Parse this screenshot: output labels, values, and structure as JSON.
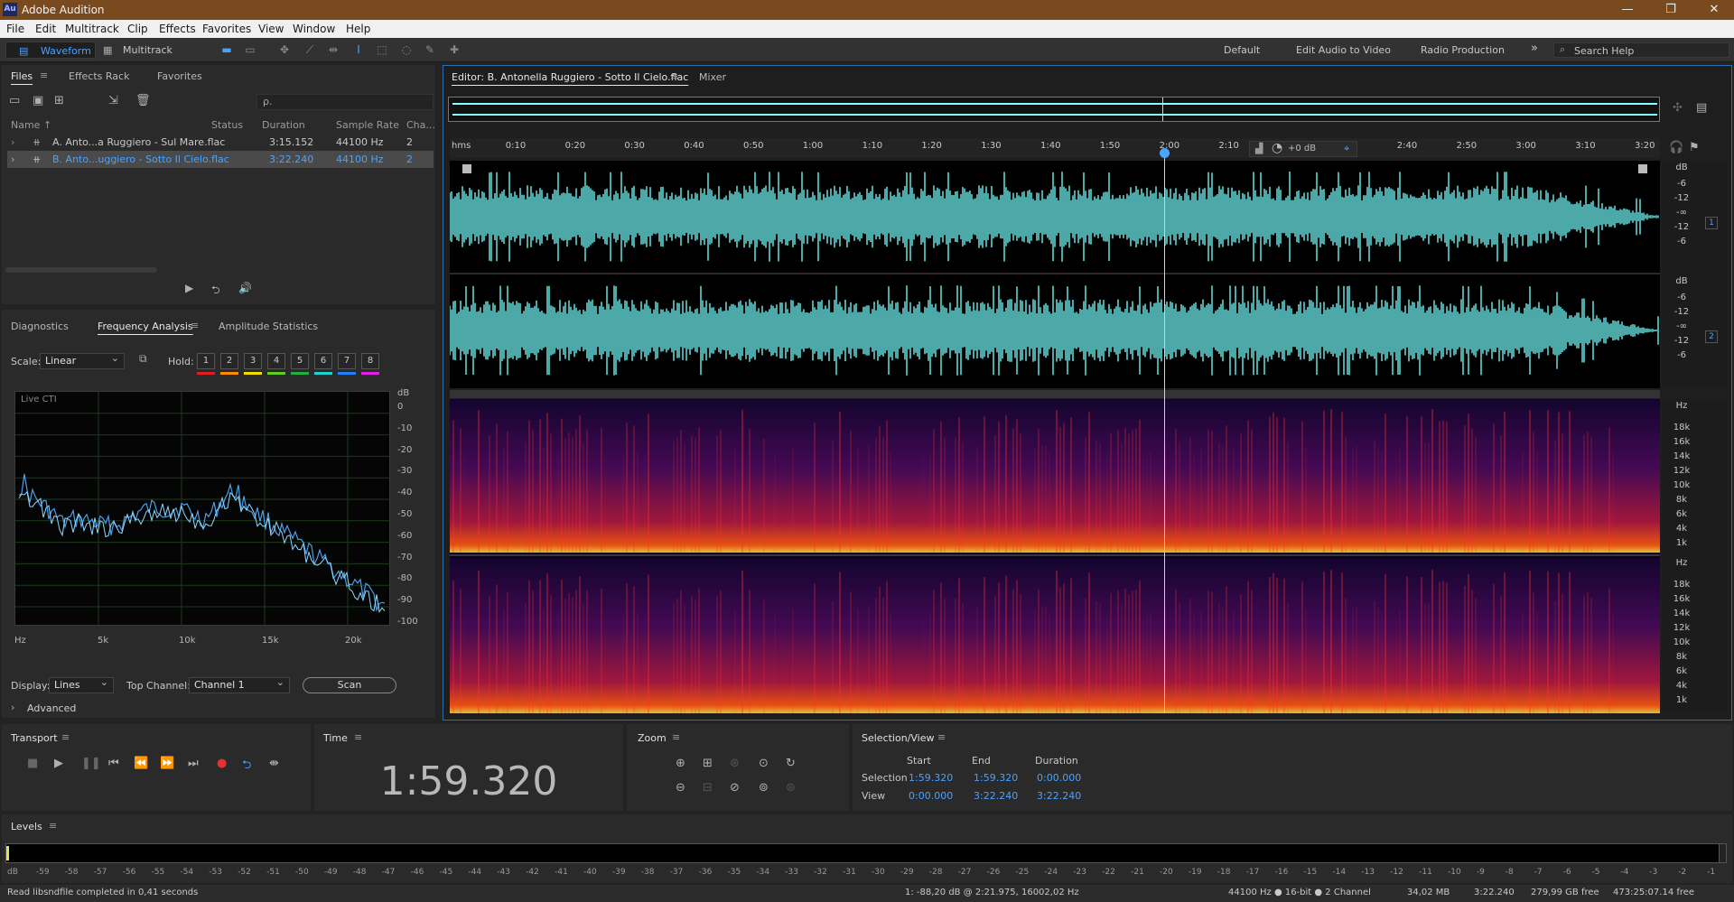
{
  "app": {
    "title": "Adobe Audition",
    "logo": "Au"
  },
  "menu": [
    "File",
    "Edit",
    "Multitrack",
    "Clip",
    "Effects",
    "Favorites",
    "View",
    "Window",
    "Help"
  ],
  "toolbar": {
    "waveform": "Waveform",
    "multitrack": "Multitrack",
    "workspaces": [
      "Default",
      "Edit Audio to Video",
      "Radio Production"
    ],
    "more": "»",
    "search_placeholder": "Search Help"
  },
  "files": {
    "tabs": [
      "Files",
      "Effects Rack",
      "Favorites"
    ],
    "columns": [
      "Name ↑",
      "Status",
      "Duration",
      "Sample Rate",
      "Cha..."
    ],
    "rows": [
      {
        "name": "A. Anto...a Ruggiero - Sul Mare.flac",
        "duration": "3:15.152",
        "rate": "44100 Hz",
        "ch": "2"
      },
      {
        "name": "B. Anto...uggiero - Sotto Il Cielo.flac",
        "duration": "3:22.240",
        "rate": "44100 Hz",
        "ch": "2"
      }
    ],
    "search_placeholder": "ρ."
  },
  "freq": {
    "tabs": [
      "Diagnostics",
      "Frequency Analysis",
      "Amplitude Statistics"
    ],
    "scale_label": "Scale:",
    "scale": "Linear",
    "hold_label": "Hold:",
    "holds": [
      "1",
      "2",
      "3",
      "4",
      "5",
      "6",
      "7",
      "8"
    ],
    "hold_colors": [
      "#e02020",
      "#ff8c00",
      "#f0e000",
      "#60d020",
      "#20b040",
      "#20d0d0",
      "#2080ff",
      "#e020e0"
    ],
    "graph_label": "Live CTI",
    "db_unit": "dB",
    "db_ticks": [
      "0",
      "-10",
      "-20",
      "-30",
      "-40",
      "-50",
      "-60",
      "-70",
      "-80",
      "-90",
      "-100"
    ],
    "hz_ticks": [
      "Hz",
      "5k",
      "10k",
      "15k",
      "20k"
    ],
    "display_label": "Display:",
    "display": "Lines",
    "topch_label": "Top Channel:",
    "topch": "Channel 1",
    "scan": "Scan",
    "advanced": "Advanced"
  },
  "editor": {
    "tab": "Editor: B. Antonella Ruggiero - Sotto Il Cielo.flac",
    "mixer": "Mixer",
    "ruler": [
      "hms",
      "0:10",
      "0:20",
      "0:30",
      "0:40",
      "0:50",
      "1:00",
      "1:10",
      "1:20",
      "1:30",
      "1:40",
      "1:50",
      "2:00",
      "2:10",
      "2:20",
      "2:30",
      "2:40",
      "2:50",
      "3:00",
      "3:10",
      "3:20"
    ],
    "volume": "+0 dB",
    "db_unit": "dB",
    "db_ticks": [
      "-6",
      "-12",
      "-∞",
      "-12",
      "-6"
    ],
    "hz_unit": "Hz",
    "hz_ticks": [
      "18k",
      "16k",
      "14k",
      "12k",
      "10k",
      "8k",
      "6k",
      "4k",
      "1k"
    ],
    "ch1": "1",
    "ch2": "2"
  },
  "transport": {
    "title": "Transport"
  },
  "time": {
    "title": "Time",
    "value": "1:59.320"
  },
  "zoom": {
    "title": "Zoom"
  },
  "selview": {
    "title": "Selection/View",
    "cols": [
      "Start",
      "End",
      "Duration"
    ],
    "rows": [
      {
        "label": "Selection",
        "start": "1:59.320",
        "end": "1:59.320",
        "dur": "0:00.000"
      },
      {
        "label": "View",
        "start": "0:00.000",
        "end": "3:22.240",
        "dur": "3:22.240"
      }
    ]
  },
  "levels": {
    "title": "Levels",
    "ticks": [
      "dB",
      "-59",
      "-58",
      "-57",
      "-56",
      "-55",
      "-54",
      "-53",
      "-52",
      "-51",
      "-50",
      "-49",
      "-48",
      "-47",
      "-46",
      "-45",
      "-44",
      "-43",
      "-42",
      "-41",
      "-40",
      "-39",
      "-38",
      "-37",
      "-36",
      "-35",
      "-34",
      "-33",
      "-32",
      "-31",
      "-30",
      "-29",
      "-28",
      "-27",
      "-26",
      "-25",
      "-24",
      "-23",
      "-22",
      "-21",
      "-20",
      "-19",
      "-18",
      "-17",
      "-16",
      "-15",
      "-14",
      "-13",
      "-12",
      "-11",
      "-10",
      "-9",
      "-8",
      "-7",
      "-6",
      "-5",
      "-4",
      "-3",
      "-2",
      "-1",
      "0"
    ]
  },
  "status": {
    "left": "Read libsndfile completed in 0,41 seconds",
    "cursor": "1: -88,20 dB @ 2:21.975, 16002,02 Hz",
    "format": "44100 Hz ● 16-bit ● 2 Channel",
    "size": "34,02 MB",
    "dur": "3:22.240",
    "free": "279,99 GB free",
    "freetime": "473:25:07.14 free"
  },
  "colors": {
    "accent": "#4aa3ff",
    "wave": "#6ef0f0",
    "playhead": "#e8e050",
    "title": "#7a4a1f"
  }
}
